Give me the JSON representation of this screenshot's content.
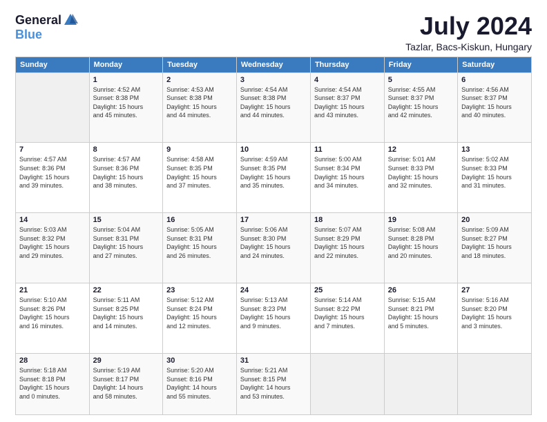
{
  "header": {
    "logo_general": "General",
    "logo_blue": "Blue",
    "month_title": "July 2024",
    "location": "Tazlar, Bacs-Kiskun, Hungary"
  },
  "weekdays": [
    "Sunday",
    "Monday",
    "Tuesday",
    "Wednesday",
    "Thursday",
    "Friday",
    "Saturday"
  ],
  "weeks": [
    [
      {
        "day": "",
        "info": ""
      },
      {
        "day": "1",
        "info": "Sunrise: 4:52 AM\nSunset: 8:38 PM\nDaylight: 15 hours\nand 45 minutes."
      },
      {
        "day": "2",
        "info": "Sunrise: 4:53 AM\nSunset: 8:38 PM\nDaylight: 15 hours\nand 44 minutes."
      },
      {
        "day": "3",
        "info": "Sunrise: 4:54 AM\nSunset: 8:38 PM\nDaylight: 15 hours\nand 44 minutes."
      },
      {
        "day": "4",
        "info": "Sunrise: 4:54 AM\nSunset: 8:37 PM\nDaylight: 15 hours\nand 43 minutes."
      },
      {
        "day": "5",
        "info": "Sunrise: 4:55 AM\nSunset: 8:37 PM\nDaylight: 15 hours\nand 42 minutes."
      },
      {
        "day": "6",
        "info": "Sunrise: 4:56 AM\nSunset: 8:37 PM\nDaylight: 15 hours\nand 40 minutes."
      }
    ],
    [
      {
        "day": "7",
        "info": "Sunrise: 4:57 AM\nSunset: 8:36 PM\nDaylight: 15 hours\nand 39 minutes."
      },
      {
        "day": "8",
        "info": "Sunrise: 4:57 AM\nSunset: 8:36 PM\nDaylight: 15 hours\nand 38 minutes."
      },
      {
        "day": "9",
        "info": "Sunrise: 4:58 AM\nSunset: 8:35 PM\nDaylight: 15 hours\nand 37 minutes."
      },
      {
        "day": "10",
        "info": "Sunrise: 4:59 AM\nSunset: 8:35 PM\nDaylight: 15 hours\nand 35 minutes."
      },
      {
        "day": "11",
        "info": "Sunrise: 5:00 AM\nSunset: 8:34 PM\nDaylight: 15 hours\nand 34 minutes."
      },
      {
        "day": "12",
        "info": "Sunrise: 5:01 AM\nSunset: 8:33 PM\nDaylight: 15 hours\nand 32 minutes."
      },
      {
        "day": "13",
        "info": "Sunrise: 5:02 AM\nSunset: 8:33 PM\nDaylight: 15 hours\nand 31 minutes."
      }
    ],
    [
      {
        "day": "14",
        "info": "Sunrise: 5:03 AM\nSunset: 8:32 PM\nDaylight: 15 hours\nand 29 minutes."
      },
      {
        "day": "15",
        "info": "Sunrise: 5:04 AM\nSunset: 8:31 PM\nDaylight: 15 hours\nand 27 minutes."
      },
      {
        "day": "16",
        "info": "Sunrise: 5:05 AM\nSunset: 8:31 PM\nDaylight: 15 hours\nand 26 minutes."
      },
      {
        "day": "17",
        "info": "Sunrise: 5:06 AM\nSunset: 8:30 PM\nDaylight: 15 hours\nand 24 minutes."
      },
      {
        "day": "18",
        "info": "Sunrise: 5:07 AM\nSunset: 8:29 PM\nDaylight: 15 hours\nand 22 minutes."
      },
      {
        "day": "19",
        "info": "Sunrise: 5:08 AM\nSunset: 8:28 PM\nDaylight: 15 hours\nand 20 minutes."
      },
      {
        "day": "20",
        "info": "Sunrise: 5:09 AM\nSunset: 8:27 PM\nDaylight: 15 hours\nand 18 minutes."
      }
    ],
    [
      {
        "day": "21",
        "info": "Sunrise: 5:10 AM\nSunset: 8:26 PM\nDaylight: 15 hours\nand 16 minutes."
      },
      {
        "day": "22",
        "info": "Sunrise: 5:11 AM\nSunset: 8:25 PM\nDaylight: 15 hours\nand 14 minutes."
      },
      {
        "day": "23",
        "info": "Sunrise: 5:12 AM\nSunset: 8:24 PM\nDaylight: 15 hours\nand 12 minutes."
      },
      {
        "day": "24",
        "info": "Sunrise: 5:13 AM\nSunset: 8:23 PM\nDaylight: 15 hours\nand 9 minutes."
      },
      {
        "day": "25",
        "info": "Sunrise: 5:14 AM\nSunset: 8:22 PM\nDaylight: 15 hours\nand 7 minutes."
      },
      {
        "day": "26",
        "info": "Sunrise: 5:15 AM\nSunset: 8:21 PM\nDaylight: 15 hours\nand 5 minutes."
      },
      {
        "day": "27",
        "info": "Sunrise: 5:16 AM\nSunset: 8:20 PM\nDaylight: 15 hours\nand 3 minutes."
      }
    ],
    [
      {
        "day": "28",
        "info": "Sunrise: 5:18 AM\nSunset: 8:18 PM\nDaylight: 15 hours\nand 0 minutes."
      },
      {
        "day": "29",
        "info": "Sunrise: 5:19 AM\nSunset: 8:17 PM\nDaylight: 14 hours\nand 58 minutes."
      },
      {
        "day": "30",
        "info": "Sunrise: 5:20 AM\nSunset: 8:16 PM\nDaylight: 14 hours\nand 55 minutes."
      },
      {
        "day": "31",
        "info": "Sunrise: 5:21 AM\nSunset: 8:15 PM\nDaylight: 14 hours\nand 53 minutes."
      },
      {
        "day": "",
        "info": ""
      },
      {
        "day": "",
        "info": ""
      },
      {
        "day": "",
        "info": ""
      }
    ]
  ]
}
